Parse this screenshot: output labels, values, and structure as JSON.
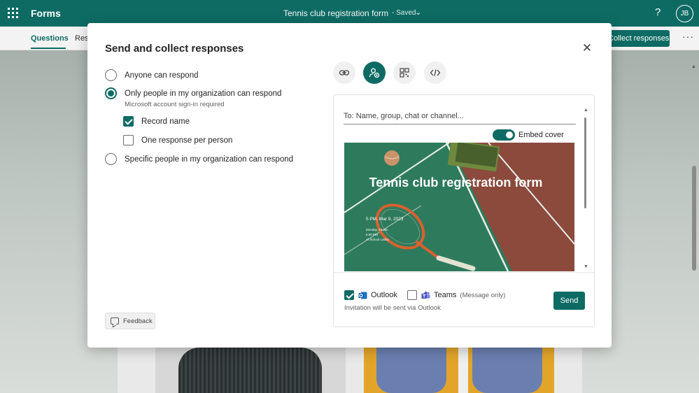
{
  "appbar": {
    "app_name": "Forms",
    "doc_title": "Tennis club registration form",
    "save_state": "Saved",
    "help_label": "?",
    "avatar_initials": "JB"
  },
  "subbar": {
    "tab_questions": "Questions",
    "tab_responses_partial": "Res",
    "collect_button": "Collect responses",
    "more_label": "···"
  },
  "dialog": {
    "title": "Send and collect responses",
    "close_label": "✕",
    "options": [
      {
        "label": "Anyone can respond",
        "selected": false
      },
      {
        "label": "Only people in my organization can respond",
        "selected": true,
        "sublabel": "Microsoft account sign-in required"
      },
      {
        "label": "Specific people in my organization can respond",
        "selected": false
      }
    ],
    "suboptions": [
      {
        "label": "Record name",
        "checked": true
      },
      {
        "label": "One response per person",
        "checked": false
      }
    ],
    "feedback_label": "Feedback",
    "share_modes": [
      {
        "icon": "link-icon",
        "selected": false
      },
      {
        "icon": "invite-people-icon",
        "selected": true
      },
      {
        "icon": "qr-code-icon",
        "selected": false
      },
      {
        "icon": "embed-code-icon",
        "selected": false
      }
    ],
    "invite": {
      "to_placeholder": "To: Name, group, chat or channel...",
      "embed_cover_label": "Embed cover",
      "embed_cover_on": true,
      "cover": {
        "title": "Tennis club registration form",
        "date": "5 PM, Mar 9, 2023",
        "line1": "Monday, 23 Jan",
        "line2": "5:00 PM",
        "line3": "At School Lobby"
      },
      "channels": [
        {
          "label": "Outlook",
          "checked": true
        },
        {
          "label": "Teams",
          "note": "(Message only)",
          "checked": false
        }
      ],
      "note": "Invitation will be sent via Outlook",
      "send_label": "Send"
    }
  },
  "colors": {
    "brand": "#0e6b64",
    "court_green": "#2e7a5c",
    "court_red": "#8b4a3c"
  }
}
